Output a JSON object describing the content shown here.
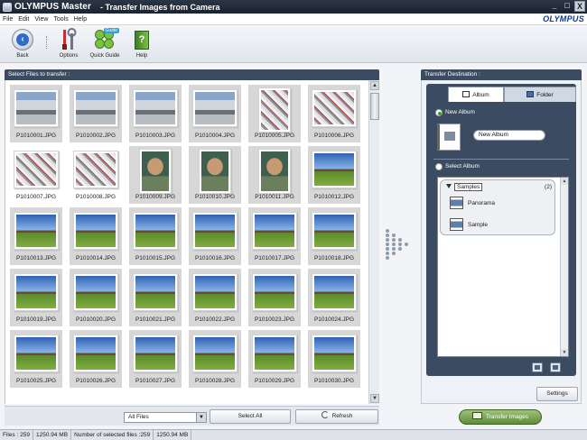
{
  "window": {
    "app_name": "OLYMPUS Master",
    "title": "- Transfer Images from Camera",
    "brand": "OLYMPUS",
    "controls": [
      "_",
      "□",
      "X"
    ]
  },
  "menu": [
    "File",
    "Edit",
    "View",
    "Tools",
    "Help"
  ],
  "toolbar": {
    "back": "Back",
    "options": "Options",
    "quick_guide": "Quick Guide",
    "quick_guide_badge": "Guide",
    "help": "Help"
  },
  "left_panel": {
    "header": "Select Files to transfer :",
    "files": [
      {
        "name": "P1010001.JPG",
        "kind": "car",
        "orientation": "landscape",
        "selected": true
      },
      {
        "name": "P1010002.JPG",
        "kind": "car",
        "orientation": "landscape",
        "selected": true
      },
      {
        "name": "P1010003.JPG",
        "kind": "car",
        "orientation": "landscape",
        "selected": true
      },
      {
        "name": "P1010004.JPG",
        "kind": "car",
        "orientation": "landscape",
        "selected": true
      },
      {
        "name": "P1010005.JPG",
        "kind": "engine",
        "orientation": "portrait",
        "selected": true
      },
      {
        "name": "P1010006.JPG",
        "kind": "engine",
        "orientation": "landscape",
        "selected": true
      },
      {
        "name": "P1010007.JPG",
        "kind": "engine",
        "orientation": "landscape",
        "selected": false
      },
      {
        "name": "P1010008.JPG",
        "kind": "engine",
        "orientation": "landscape",
        "selected": false
      },
      {
        "name": "P1010009.JPG",
        "kind": "portrait",
        "orientation": "portrait",
        "selected": true
      },
      {
        "name": "P1010010.JPG",
        "kind": "portrait",
        "orientation": "portrait",
        "selected": true
      },
      {
        "name": "P1010011.JPG",
        "kind": "portrait",
        "orientation": "portrait",
        "selected": true
      },
      {
        "name": "P1010012.JPG",
        "kind": "house",
        "orientation": "landscape",
        "selected": true
      },
      {
        "name": "P1010013.JPG",
        "kind": "house",
        "orientation": "landscape",
        "selected": true
      },
      {
        "name": "P1010014.JPG",
        "kind": "house",
        "orientation": "landscape",
        "selected": true
      },
      {
        "name": "P1010015.JPG",
        "kind": "house",
        "orientation": "landscape",
        "selected": true
      },
      {
        "name": "P1010016.JPG",
        "kind": "house",
        "orientation": "landscape",
        "selected": true
      },
      {
        "name": "P1010017.JPG",
        "kind": "house",
        "orientation": "landscape",
        "selected": true
      },
      {
        "name": "P1010018.JPG",
        "kind": "house",
        "orientation": "landscape",
        "selected": true
      },
      {
        "name": "P1010019.JPG",
        "kind": "house",
        "orientation": "landscape",
        "selected": true
      },
      {
        "name": "P1010020.JPG",
        "kind": "house",
        "orientation": "landscape",
        "selected": true
      },
      {
        "name": "P1010021.JPG",
        "kind": "house",
        "orientation": "landscape",
        "selected": true
      },
      {
        "name": "P1010022.JPG",
        "kind": "house",
        "orientation": "landscape",
        "selected": true
      },
      {
        "name": "P1010023.JPG",
        "kind": "house",
        "orientation": "landscape",
        "selected": true
      },
      {
        "name": "P1010024.JPG",
        "kind": "house",
        "orientation": "landscape",
        "selected": true
      },
      {
        "name": "P1010025.JPG",
        "kind": "house",
        "orientation": "landscape",
        "selected": true
      },
      {
        "name": "P1010026.JPG",
        "kind": "house",
        "orientation": "landscape",
        "selected": true
      },
      {
        "name": "P1010027.JPG",
        "kind": "house",
        "orientation": "landscape",
        "selected": true
      },
      {
        "name": "P1010028.JPG",
        "kind": "house",
        "orientation": "landscape",
        "selected": true
      },
      {
        "name": "P1010029.JPG",
        "kind": "house",
        "orientation": "landscape",
        "selected": true
      },
      {
        "name": "P1010030.JPG",
        "kind": "house",
        "orientation": "landscape",
        "selected": true
      }
    ],
    "filter_value": "All Files",
    "select_all": "Select All",
    "refresh": "Refresh"
  },
  "right_panel": {
    "header": "Transfer Destination :",
    "tabs": [
      "Album",
      "Folder"
    ],
    "new_album_label": "New Album",
    "new_album_value": "New Album",
    "select_album_label": "Select Album",
    "group_name": "Samples",
    "group_count": "(2)",
    "albums": [
      "Panorama",
      "Sample"
    ],
    "settings": "Settings",
    "transfer": "Transfer Images"
  },
  "status": {
    "files": "Files : 259",
    "size": "1250.94 MB",
    "selected_label": "Number of selected files :259",
    "selected_size": "1250.94 MB"
  },
  "colors": {
    "header_bg": "#3b4b62",
    "transfer_green": "#6f9b45",
    "selected_cell": "#d7d7d7"
  }
}
